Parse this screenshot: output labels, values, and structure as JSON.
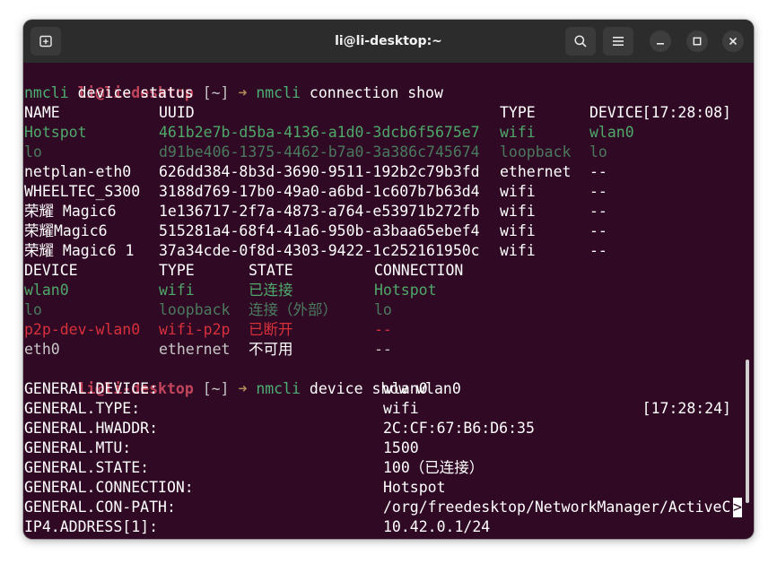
{
  "window": {
    "title": "li@li-desktop:~",
    "colors": {
      "terminal_bg": "#300a24",
      "titlebar_bg": "#2c2c2c",
      "prompt_user": "#c3455c",
      "green": "#4ea86a",
      "red": "#d8303b"
    }
  },
  "titlebar": {
    "new_tab_icon": "new-tab-icon",
    "search_icon": "search-icon",
    "menu_icon": "hamburger-menu-icon",
    "minimize_icon": "minimize-icon",
    "maximize_icon": "maximize-icon",
    "close_icon": "close-icon"
  },
  "prompts": [
    {
      "user": "li@li-desktop",
      "dir": "[~]",
      "arrow": "➜",
      "cmd": "nmcli",
      "args": " connection show",
      "time": "[17:28:08]"
    },
    {
      "user": "li@li-desktop",
      "dir": "[~]",
      "arrow": "➜",
      "cmd": "nmcli",
      "args": " device show wlan0",
      "time": "[17:28:24]"
    }
  ],
  "typed_line": {
    "cmd": "nmcli",
    "args": " device status"
  },
  "connection_table": {
    "headers": [
      "NAME",
      "UUID",
      "TYPE",
      "DEVICE"
    ],
    "rows": [
      {
        "name": "Hotspot",
        "uuid": "461b2e7b-d5ba-4136-a1d0-3dcb6f5675e7",
        "type": "wifi",
        "device": "wlan0",
        "style": "green"
      },
      {
        "name": "lo",
        "uuid": "d91be406-1375-4462-b7a0-3a386c745674",
        "type": "loopback",
        "device": "lo",
        "style": "dim"
      },
      {
        "name": "netplan-eth0",
        "uuid": "626dd384-8b3d-3690-9511-192b2c79b3fd",
        "type": "ethernet",
        "device": "--",
        "style": "plain"
      },
      {
        "name": "WHEELTEC_S300",
        "uuid": "3188d769-17b0-49a0-a6bd-1c607b7b63d4",
        "type": "wifi",
        "device": "--",
        "style": "plain"
      },
      {
        "name": "荣耀 Magic6",
        "uuid": "1e136717-2f7a-4873-a764-e53971b272fb",
        "type": "wifi",
        "device": "--",
        "style": "plain"
      },
      {
        "name": "荣耀Magic6",
        "uuid": "515281a4-68f4-41a6-950b-a3baa65ebef4",
        "type": "wifi",
        "device": "--",
        "style": "plain"
      },
      {
        "name": "荣耀 Magic6 1",
        "uuid": "37a34cde-0f8d-4303-9422-1c252161950c",
        "type": "wifi",
        "device": "--",
        "style": "plain"
      }
    ]
  },
  "device_table": {
    "headers": [
      "DEVICE",
      "TYPE",
      "STATE",
      "CONNECTION"
    ],
    "rows": [
      {
        "device": "wlan0",
        "type": "wifi",
        "state": "已连接",
        "connection": "Hotspot",
        "style": "green"
      },
      {
        "device": "lo",
        "type": "loopback",
        "state": "连接（外部）",
        "connection": "lo",
        "style": "dim"
      },
      {
        "device": "p2p-dev-wlan0",
        "type": "wifi-p2p",
        "state": "已断开",
        "connection": "--",
        "style": "red"
      },
      {
        "device": "eth0",
        "type": "ethernet",
        "state": "不可用",
        "connection": "--",
        "style": "gray"
      }
    ]
  },
  "device_show": [
    {
      "key": "GENERAL.DEVICE:",
      "value": "wlan0"
    },
    {
      "key": "GENERAL.TYPE:",
      "value": "wifi"
    },
    {
      "key": "GENERAL.HWADDR:",
      "value": "2C:CF:67:B6:D6:35"
    },
    {
      "key": "GENERAL.MTU:",
      "value": "1500"
    },
    {
      "key": "GENERAL.STATE:",
      "value": "100（已连接）"
    },
    {
      "key": "GENERAL.CONNECTION:",
      "value": "Hotspot"
    },
    {
      "key": "GENERAL.CON-PATH:",
      "value": "/org/freedesktop/NetworkManager/ActiveC"
    },
    {
      "key": "IP4.ADDRESS[1]:",
      "value": "10.42.0.1/24"
    }
  ],
  "pager_more_indicator": ">"
}
